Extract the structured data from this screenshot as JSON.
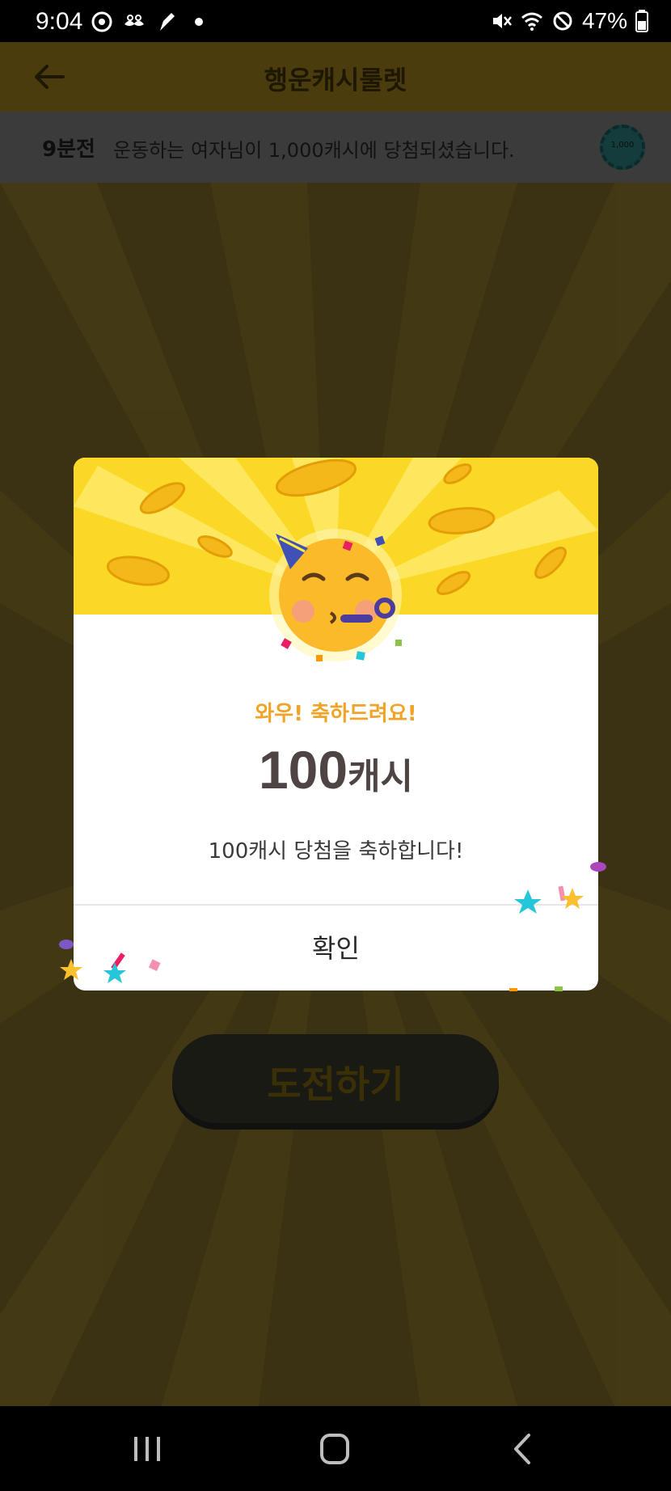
{
  "status_bar": {
    "time": "9:04",
    "battery": "47%",
    "left_icons": [
      "messenger-icon",
      "mustache-app-icon",
      "game-icon",
      "dot-icon"
    ],
    "right_icons": [
      "mute-icon",
      "wifi-icon",
      "do-not-disturb-icon",
      "battery-icon"
    ]
  },
  "header": {
    "title": "행운캐시룰렛"
  },
  "ticker": {
    "time_ago": "9분전",
    "message": "운동하는 여자님이 1,000캐시에 당첨되셨습니다.",
    "chip_label": "1,000"
  },
  "challenge_button": {
    "label": "도전하기"
  },
  "dialog": {
    "title": "와우! 축하드려요!",
    "amount_number": "100",
    "amount_unit": "캐시",
    "message": "100캐시 당첨을 축하합니다!",
    "confirm_label": "확인"
  },
  "colors": {
    "dialog_top": "#fcd826",
    "title_orange": "#f0a326",
    "amount_text": "#4f4444",
    "dimmed_bg": "#3a3212"
  }
}
